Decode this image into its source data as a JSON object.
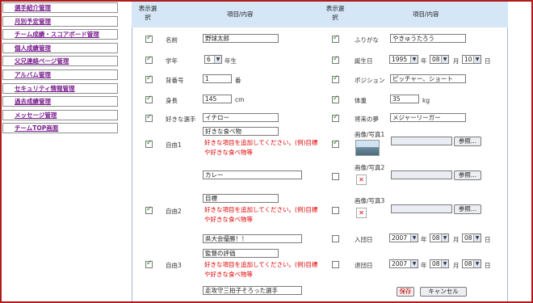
{
  "sidebar": {
    "items": [
      {
        "label": "選手紹介管理"
      },
      {
        "label": "月別予定管理"
      },
      {
        "label": "チーム成績・スコアボード管理"
      },
      {
        "label": "個人成績管理"
      },
      {
        "label": "父兄連絡ページ管理"
      },
      {
        "label": "アルバム管理"
      },
      {
        "label": "セキュリティ情報管理"
      },
      {
        "label": "過去成績管理"
      },
      {
        "label": "メッセージ管理"
      },
      {
        "label": "チームTOP画面"
      }
    ]
  },
  "header": {
    "display_select_line1": "表示選",
    "display_select_line2": "択",
    "item_content": "項目/内容"
  },
  "left": {
    "name": {
      "label": "名前",
      "value": "野球太郎"
    },
    "grade": {
      "label": "学年",
      "value": "6",
      "unit": "年生"
    },
    "number": {
      "label": "背番号",
      "value": "1",
      "unit": "番"
    },
    "height": {
      "label": "身長",
      "value": "145",
      "unit": "cm"
    },
    "favorite_player": {
      "label": "好きな選手",
      "value": "イチロー"
    },
    "free1": {
      "label": "自由1",
      "value": "好きな食べ物",
      "note1": "好きな項目を追加してください。(例)目標",
      "note2": "や好きな食べ物等",
      "value2": "カレー"
    },
    "free2": {
      "label": "自由2",
      "value": "目標",
      "note1": "好きな項目を追加してください。(例)目標",
      "note2": "や好きな食べ物等",
      "value2": "県大会優勝！！"
    },
    "free3": {
      "label": "自由3",
      "value": "監督の評価",
      "note1": "好きな項目を追加してください。(例)目標",
      "note2": "や好きな食べ物等",
      "value2": "走攻守三拍子そろった選手"
    }
  },
  "right": {
    "furigana": {
      "label": "ふりがな",
      "value": "やきゅうたろう"
    },
    "birthday": {
      "label": "誕生日",
      "year": "1995",
      "year_unit": "年",
      "month": "08",
      "month_unit": "月",
      "day": "10",
      "day_unit": "日"
    },
    "position": {
      "label": "ポジション",
      "value": "ピッチャー、ショート"
    },
    "weight": {
      "label": "体重",
      "value": "35",
      "unit": "kg"
    },
    "dream": {
      "label": "将来の夢",
      "value": "メジャーリーガー"
    },
    "photo1": {
      "label": "画像/写真1",
      "browse": "参照..."
    },
    "photo2": {
      "label": "画像/写真2",
      "browse": "参照...",
      "broken": "✕"
    },
    "photo3": {
      "label": "画像/写真3",
      "browse": "参照...",
      "broken": "✕"
    },
    "join_date": {
      "label": "入団日",
      "year": "2007",
      "year_unit": "年",
      "month": "08",
      "month_unit": "月",
      "day": "08",
      "day_unit": "日"
    },
    "leave_date": {
      "label": "退団日",
      "year": "2007",
      "year_unit": "年",
      "month": "08",
      "month_unit": "月",
      "day": "08",
      "day_unit": "日"
    }
  },
  "actions": {
    "save": "保存",
    "cancel": "キャンセル"
  },
  "icons": {
    "dropdown": "▼"
  }
}
